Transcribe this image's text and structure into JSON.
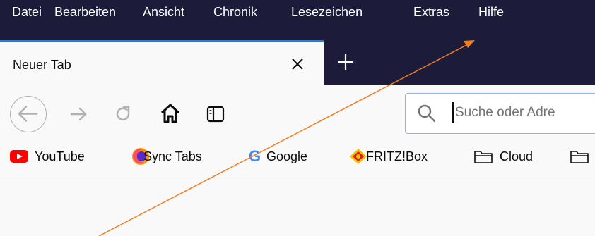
{
  "menu": {
    "items": [
      {
        "label": "Datei"
      },
      {
        "label": "Bearbeiten"
      },
      {
        "label": "Ansicht"
      },
      {
        "label": "Chronik"
      },
      {
        "label": "Lesezeichen"
      },
      {
        "label": "Extras"
      },
      {
        "label": "Hilfe"
      }
    ]
  },
  "tabs": {
    "active_title": "Neuer Tab"
  },
  "urlbar": {
    "placeholder": "Suche oder Adre"
  },
  "bookmarks": [
    {
      "label": "YouTube",
      "icon": "youtube-icon"
    },
    {
      "label": "Sync Tabs",
      "icon": "firefox-icon"
    },
    {
      "label": "Google",
      "icon": "google-icon"
    },
    {
      "label": "FRITZ!Box",
      "icon": "fritzbox-icon"
    },
    {
      "label": "Cloud",
      "icon": "folder-icon"
    }
  ],
  "colors": {
    "chrome_dark": "#1c1c3a",
    "tab_accent": "#0a84ff",
    "annotation_arrow": "#f07d20"
  }
}
